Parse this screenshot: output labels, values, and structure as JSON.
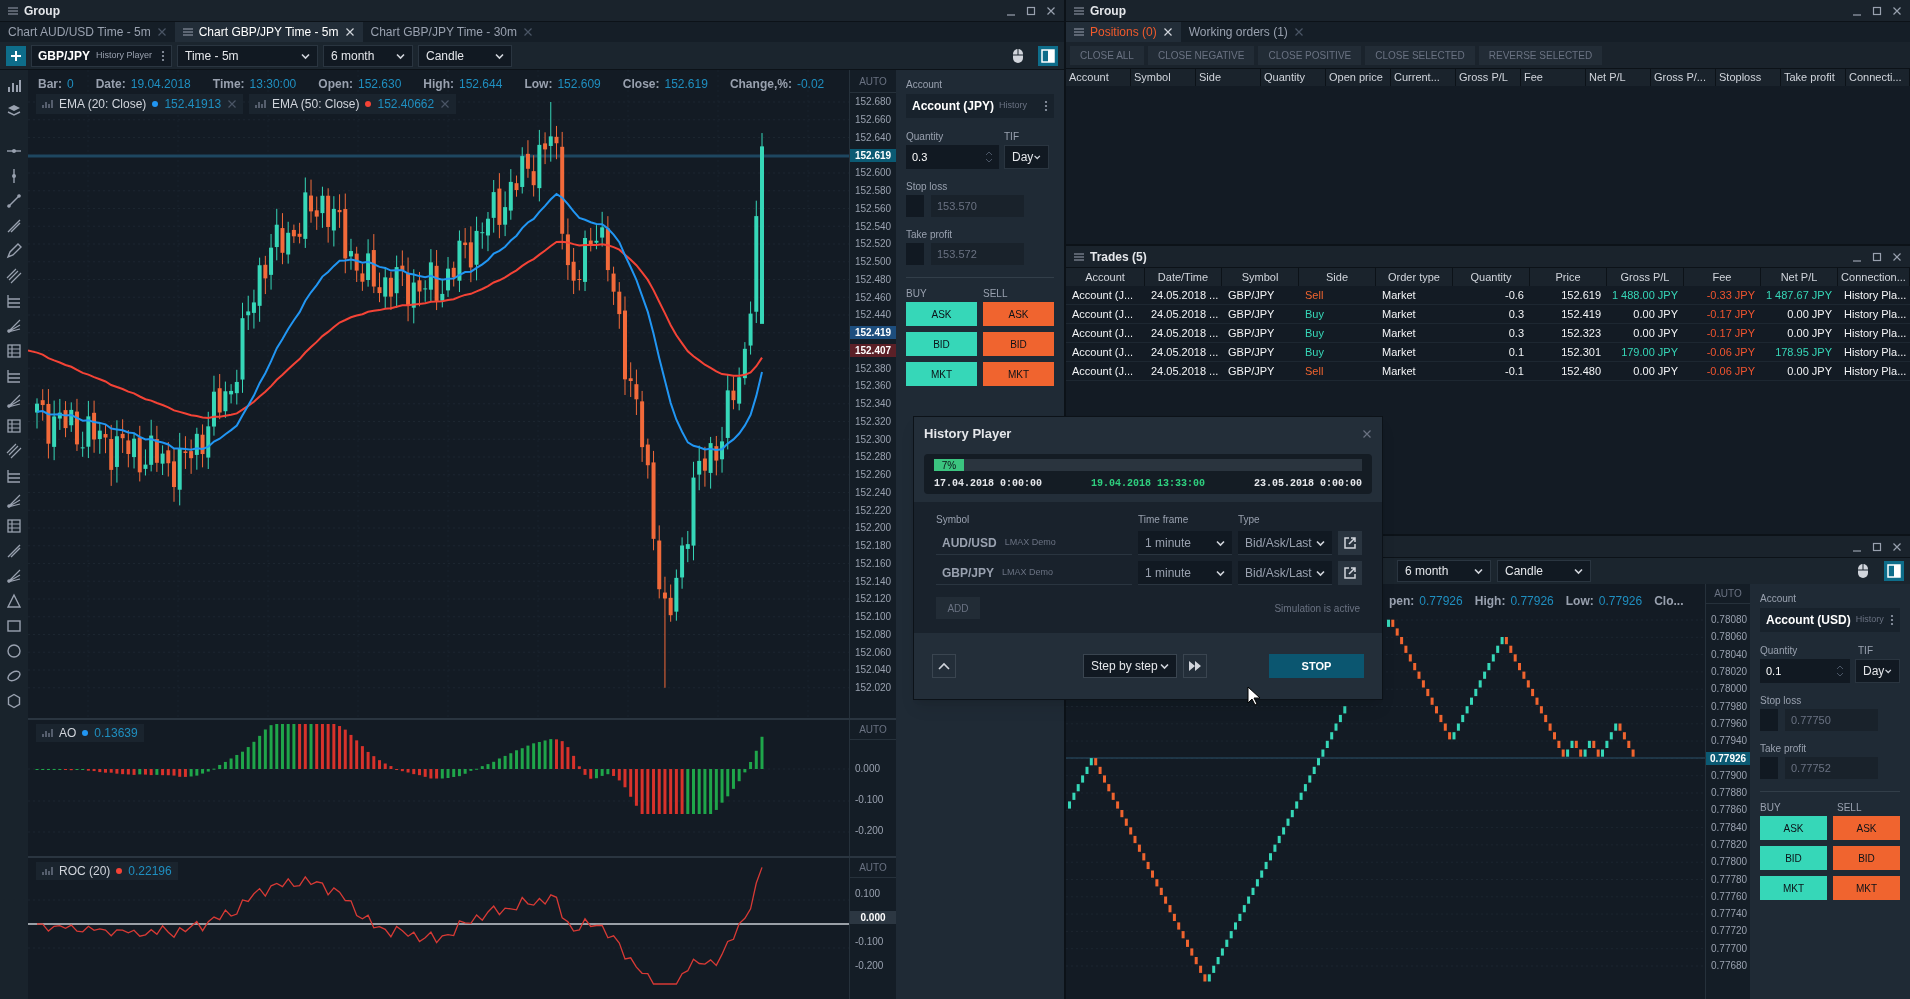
{
  "left_window": {
    "title": "Group",
    "tabs": [
      {
        "label": "Chart AUD/USD Time - 5m",
        "selected": false
      },
      {
        "label": "Chart GBP/JPY Time - 5m",
        "selected": true
      },
      {
        "label": "Chart GBP/JPY Time - 30m",
        "selected": false
      }
    ],
    "toolbar": {
      "symbol": "GBP/JPY",
      "source": "History Player",
      "timeframe": "Time - 5m",
      "range": "6 month",
      "chart_type": "Candle"
    },
    "info_bar": [
      {
        "label": "Bar:",
        "value": "0"
      },
      {
        "label": "Date:",
        "value": "19.04.2018"
      },
      {
        "label": "Time:",
        "value": "13:30:00"
      },
      {
        "label": "Open:",
        "value": "152.630"
      },
      {
        "label": "High:",
        "value": "152.644"
      },
      {
        "label": "Low:",
        "value": "152.609"
      },
      {
        "label": "Close:",
        "value": "152.619"
      },
      {
        "label": "Change,%:",
        "value": "-0.02"
      }
    ],
    "indicators": [
      {
        "name": "EMA (20: Close)",
        "value": "152.41913",
        "color": "#2196f3"
      },
      {
        "name": "EMA (50: Close)",
        "value": "152.40662",
        "color": "#f44336"
      }
    ],
    "price_axis": {
      "mode": "AUTO",
      "items": [
        {
          "text": "152.680",
          "kind": "tick"
        },
        {
          "text": "152.660",
          "kind": "tick"
        },
        {
          "text": "152.640",
          "kind": "tick"
        },
        {
          "text": "152.619",
          "kind": "badge",
          "color": "#0b5a73"
        },
        {
          "text": "152.600",
          "kind": "tick"
        },
        {
          "text": "152.580",
          "kind": "tick"
        },
        {
          "text": "152.560",
          "kind": "tick"
        },
        {
          "text": "152.540",
          "kind": "tick"
        },
        {
          "text": "152.520",
          "kind": "tick"
        },
        {
          "text": "152.500",
          "kind": "tick"
        },
        {
          "text": "152.480",
          "kind": "tick"
        },
        {
          "text": "152.460",
          "kind": "tick"
        },
        {
          "text": "152.440",
          "kind": "tick"
        },
        {
          "text": "152.419",
          "kind": "badge",
          "color": "#1d4e7e"
        },
        {
          "text": "152.407",
          "kind": "badge",
          "color": "#5b2027"
        },
        {
          "text": "152.380",
          "kind": "tick"
        },
        {
          "text": "152.360",
          "kind": "tick"
        },
        {
          "text": "152.340",
          "kind": "tick"
        },
        {
          "text": "152.320",
          "kind": "tick"
        },
        {
          "text": "152.300",
          "kind": "tick"
        },
        {
          "text": "152.280",
          "kind": "tick"
        },
        {
          "text": "152.260",
          "kind": "tick"
        },
        {
          "text": "152.240",
          "kind": "tick"
        },
        {
          "text": "152.220",
          "kind": "tick"
        },
        {
          "text": "152.200",
          "kind": "tick"
        },
        {
          "text": "152.180",
          "kind": "tick"
        },
        {
          "text": "152.160",
          "kind": "tick"
        },
        {
          "text": "152.140",
          "kind": "tick"
        },
        {
          "text": "152.120",
          "kind": "tick"
        },
        {
          "text": "152.100",
          "kind": "tick"
        },
        {
          "text": "152.080",
          "kind": "tick"
        },
        {
          "text": "152.060",
          "kind": "tick"
        },
        {
          "text": "152.040",
          "kind": "tick"
        },
        {
          "text": "152.020",
          "kind": "tick"
        }
      ]
    },
    "ao": {
      "name": "AO",
      "value": "0.13639",
      "color": "#2196f3",
      "axis": {
        "mode": "AUTO",
        "items": [
          {
            "text": "0.000",
            "kind": "tick"
          },
          {
            "text": "-0.100",
            "kind": "tick"
          },
          {
            "text": "-0.200",
            "kind": "tick"
          }
        ]
      }
    },
    "roc": {
      "name": "ROC (20)",
      "value": "0.22196",
      "color": "#f44336",
      "axis": {
        "mode": "AUTO",
        "items": [
          {
            "text": "0.100",
            "kind": "tick"
          },
          {
            "text": "0.000",
            "kind": "badge",
            "color": "#2c3742"
          },
          {
            "text": "-0.100",
            "kind": "tick"
          },
          {
            "text": "-0.200",
            "kind": "tick"
          }
        ]
      }
    },
    "order_panel": {
      "account_label": "Account",
      "account": "Account (JPY)",
      "account_source": "History",
      "quantity_label": "Quantity",
      "quantity": "0.3",
      "tif_label": "TIF",
      "tif": "Day",
      "stop_loss": {
        "label": "Stop loss",
        "checked": false,
        "value": "153.570",
        "disabled": true
      },
      "take_profit": {
        "label": "Take profit",
        "checked": false,
        "value": "153.572",
        "disabled": true
      },
      "buy_label": "BUY",
      "sell_label": "SELL",
      "buy_buttons": [
        "ASK",
        "BID",
        "MKT"
      ],
      "sell_buttons": [
        "ASK",
        "BID",
        "MKT"
      ]
    }
  },
  "positions_group": {
    "title": "Group",
    "tabs": [
      {
        "label": "Positions (0)",
        "selected": true
      },
      {
        "label": "Working orders (1)",
        "selected": false
      }
    ],
    "actions": [
      {
        "label": "CLOSE ALL",
        "disabled": true
      },
      {
        "label": "CLOSE NEGATIVE",
        "disabled": true
      },
      {
        "label": "CLOSE POSITIVE",
        "disabled": true
      },
      {
        "label": "CLOSE SELECTED",
        "disabled": true
      },
      {
        "label": "REVERSE SELECTED",
        "disabled": true
      }
    ],
    "columns": [
      "Account",
      "Symbol",
      "Side",
      "Quantity",
      "Open price",
      "Current...",
      "Gross P/L",
      "Fee",
      "Net P/L",
      "Gross P/...",
      "Stoploss",
      "Take profit",
      "Connecti..."
    ]
  },
  "trades": {
    "title": "Trades (5)",
    "columns": [
      "Account",
      "Date/Time",
      "Symbol",
      "Side",
      "Order type",
      "Quantity",
      "Price",
      "Gross P/L",
      "Fee",
      "Net P/L",
      "Connection..."
    ],
    "rows": [
      {
        "account": "Account (J...",
        "datetime": "24.05.2018 ...",
        "symbol": "GBP/JPY",
        "side": {
          "text": "Sell",
          "color": "#f0642f"
        },
        "order_type": "Market",
        "quantity": "-0.6",
        "price": "152.619",
        "gross_pl": {
          "text": "1 488.00 JPY",
          "color": "#36d7b8"
        },
        "fee": {
          "text": "-0.33 JPY",
          "color": "#f0542f"
        },
        "net_pl": {
          "text": "1 487.67 JPY",
          "color": "#36d7b8"
        },
        "connection": "History Pla..."
      },
      {
        "account": "Account (J...",
        "datetime": "24.05.2018 ...",
        "symbol": "GBP/JPY",
        "side": {
          "text": "Buy",
          "color": "#36d7b8"
        },
        "order_type": "Market",
        "quantity": "0.3",
        "price": "152.419",
        "gross_pl": {
          "text": "0.00 JPY",
          "color": "#f3f4f6"
        },
        "fee": {
          "text": "-0.17 JPY",
          "color": "#f0542f"
        },
        "net_pl": {
          "text": "0.00 JPY",
          "color": "#f3f4f6"
        },
        "connection": "History Pla..."
      },
      {
        "account": "Account (J...",
        "datetime": "24.05.2018 ...",
        "symbol": "GBP/JPY",
        "side": {
          "text": "Buy",
          "color": "#36d7b8"
        },
        "order_type": "Market",
        "quantity": "0.3",
        "price": "152.323",
        "gross_pl": {
          "text": "0.00 JPY",
          "color": "#f3f4f6"
        },
        "fee": {
          "text": "-0.17 JPY",
          "color": "#f0542f"
        },
        "net_pl": {
          "text": "0.00 JPY",
          "color": "#f3f4f6"
        },
        "connection": "History Pla..."
      },
      {
        "account": "Account (J...",
        "datetime": "24.05.2018 ...",
        "symbol": "GBP/JPY",
        "side": {
          "text": "Buy",
          "color": "#36d7b8"
        },
        "order_type": "Market",
        "quantity": "0.1",
        "price": "152.301",
        "gross_pl": {
          "text": "179.00 JPY",
          "color": "#36d7b8"
        },
        "fee": {
          "text": "-0.06 JPY",
          "color": "#f0542f"
        },
        "net_pl": {
          "text": "178.95 JPY",
          "color": "#36d7b8"
        },
        "connection": "History Pla..."
      },
      {
        "account": "Account (J...",
        "datetime": "24.05.2018 ...",
        "symbol": "GBP/JPY",
        "side": {
          "text": "Sell",
          "color": "#f0642f"
        },
        "order_type": "Market",
        "quantity": "-0.1",
        "price": "152.480",
        "gross_pl": {
          "text": "0.00 JPY",
          "color": "#f3f4f6"
        },
        "fee": {
          "text": "-0.06 JPY",
          "color": "#f0542f"
        },
        "net_pl": {
          "text": "0.00 JPY",
          "color": "#f3f4f6"
        },
        "connection": "History Pla..."
      }
    ]
  },
  "renko_window": {
    "range": "6 month",
    "chart_type": "Candle",
    "info_bar": [
      {
        "label": "pen:",
        "value": "0.77926"
      },
      {
        "label": "High:",
        "value": "0.77926"
      },
      {
        "label": "Low:",
        "value": "0.77926"
      }
    ],
    "info_cut_label": "Clo...",
    "price_axis": {
      "mode": "AUTO",
      "items": [
        {
          "text": "0.78080",
          "kind": "tick"
        },
        {
          "text": "0.78060",
          "kind": "tick"
        },
        {
          "text": "0.78040",
          "kind": "tick"
        },
        {
          "text": "0.78020",
          "kind": "tick"
        },
        {
          "text": "0.78000",
          "kind": "tick"
        },
        {
          "text": "0.77980",
          "kind": "tick"
        },
        {
          "text": "0.77960",
          "kind": "tick"
        },
        {
          "text": "0.77940",
          "kind": "tick"
        },
        {
          "text": "0.77926",
          "kind": "badge",
          "color": "#0b5a73"
        },
        {
          "text": "0.77900",
          "kind": "tick"
        },
        {
          "text": "0.77880",
          "kind": "tick"
        },
        {
          "text": "0.77860",
          "kind": "tick"
        },
        {
          "text": "0.77840",
          "kind": "tick"
        },
        {
          "text": "0.77820",
          "kind": "tick"
        },
        {
          "text": "0.77800",
          "kind": "tick"
        },
        {
          "text": "0.77780",
          "kind": "tick"
        },
        {
          "text": "0.77760",
          "kind": "tick"
        },
        {
          "text": "0.77740",
          "kind": "tick"
        },
        {
          "text": "0.77720",
          "kind": "tick"
        },
        {
          "text": "0.77700",
          "kind": "tick"
        },
        {
          "text": "0.77680",
          "kind": "tick"
        }
      ]
    },
    "order_panel": {
      "account_label": "Account",
      "account": "Account (USD)",
      "account_source": "History",
      "quantity_label": "Quantity",
      "quantity": "0.1",
      "tif_label": "TIF",
      "tif": "Day",
      "stop_loss": {
        "label": "Stop loss",
        "checked": false,
        "value": "0.77750",
        "disabled": true
      },
      "take_profit": {
        "label": "Take profit",
        "checked": false,
        "value": "0.77752",
        "disabled": true
      },
      "buy_label": "BUY",
      "sell_label": "SELL",
      "buy_buttons": [
        "ASK",
        "BID",
        "MKT"
      ],
      "sell_buttons": [
        "ASK",
        "BID",
        "MKT"
      ]
    }
  },
  "history_player": {
    "title": "History Player",
    "progress": {
      "level": 0.07,
      "label": "7%",
      "start": "17.04.2018 0:00:00",
      "current": "19.04.2018 13:33:00",
      "end": "23.05.2018 0:00:00"
    },
    "columns": [
      "Symbol",
      "Time frame",
      "Type"
    ],
    "rows": [
      {
        "symbol": "AUD/USD",
        "source": "LMAX Demo",
        "timeframe": "1 minute",
        "type": "Bid/Ask/Last"
      },
      {
        "symbol": "GBP/JPY",
        "source": "LMAX Demo",
        "timeframe": "1 minute",
        "type": "Bid/Ask/Last"
      }
    ],
    "add_label": "ADD",
    "status": "Simulation is active",
    "mode": "Step by step",
    "stop_label": "STOP"
  }
}
